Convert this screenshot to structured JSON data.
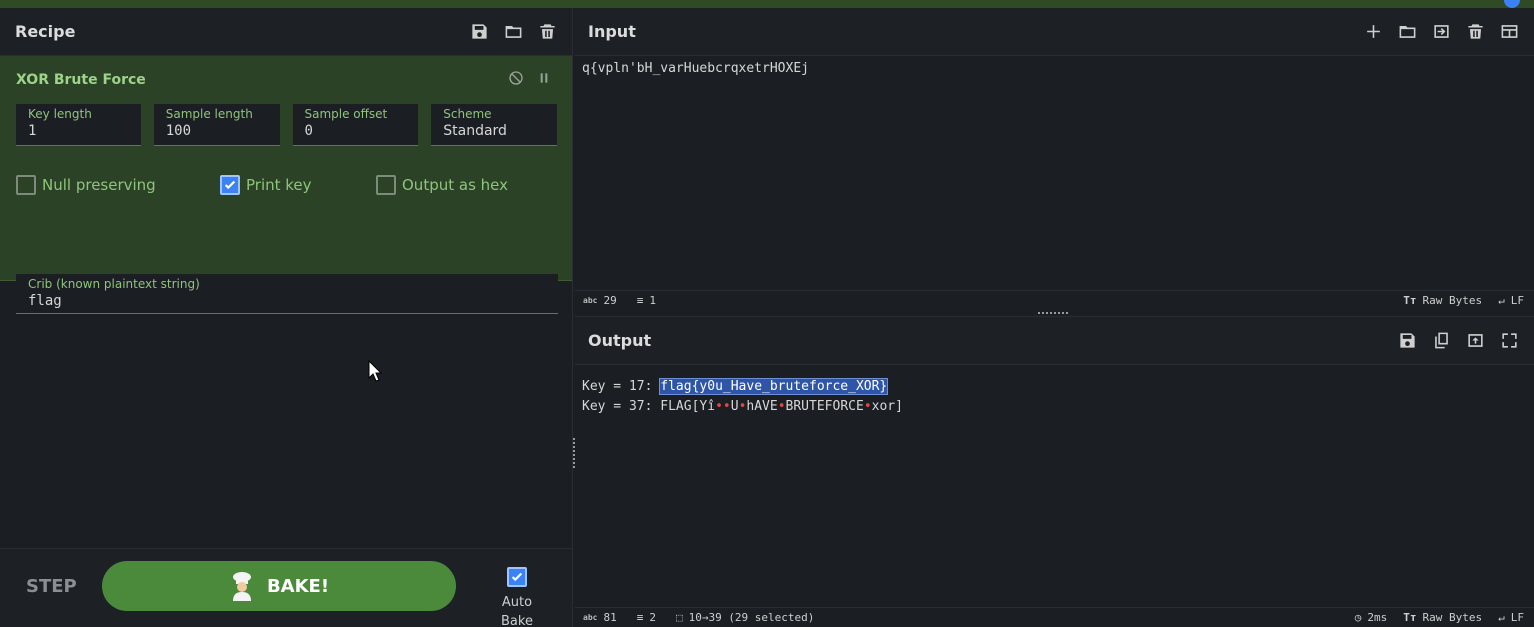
{
  "recipe": {
    "title": "Recipe",
    "operation": {
      "name": "XOR Brute Force",
      "fields": [
        {
          "label": "Key length",
          "value": "1"
        },
        {
          "label": "Sample length",
          "value": "100"
        },
        {
          "label": "Sample offset",
          "value": "0"
        },
        {
          "label": "Scheme",
          "value": "Standard"
        }
      ],
      "checkboxes": [
        {
          "label": "Null preserving",
          "checked": false
        },
        {
          "label": "Print key",
          "checked": true
        },
        {
          "label": "Output as hex",
          "checked": false
        }
      ],
      "crib": {
        "label": "Crib (known plaintext string)",
        "value": "flag"
      }
    },
    "step_label": "STEP",
    "bake_label": "BAKE!",
    "auto_bake_label": "Auto Bake"
  },
  "input": {
    "title": "Input",
    "text": "q{vpln'bH_varHuebcrqxetrHOXEj",
    "status": {
      "chars": "29",
      "lines": "1",
      "encoding": "Raw Bytes",
      "eol": "LF"
    }
  },
  "output": {
    "title": "Output",
    "line1_prefix": "Key = 17: ",
    "line1_selected": "flag{y0u_Have_bruteforce_XOR}",
    "line2_prefix": "Key = 37: ",
    "line2_a": "FLAG[Yî",
    "line2_b": "U",
    "line2_c": "hAVE",
    "line2_d": "BRUTEFORCE",
    "line2_e": "xor]",
    "status": {
      "chars": "81",
      "lines": "2",
      "selection": "10→39 (29 selected)",
      "time": "2ms",
      "encoding": "Raw Bytes",
      "eol": "LF"
    }
  },
  "icons": {
    "abc": "abc",
    "tt": "Tт",
    "dots": "••"
  },
  "colors": {
    "accent": "#3b82f6",
    "bake": "#4b8a3b",
    "op_bg": "#2b4226"
  }
}
